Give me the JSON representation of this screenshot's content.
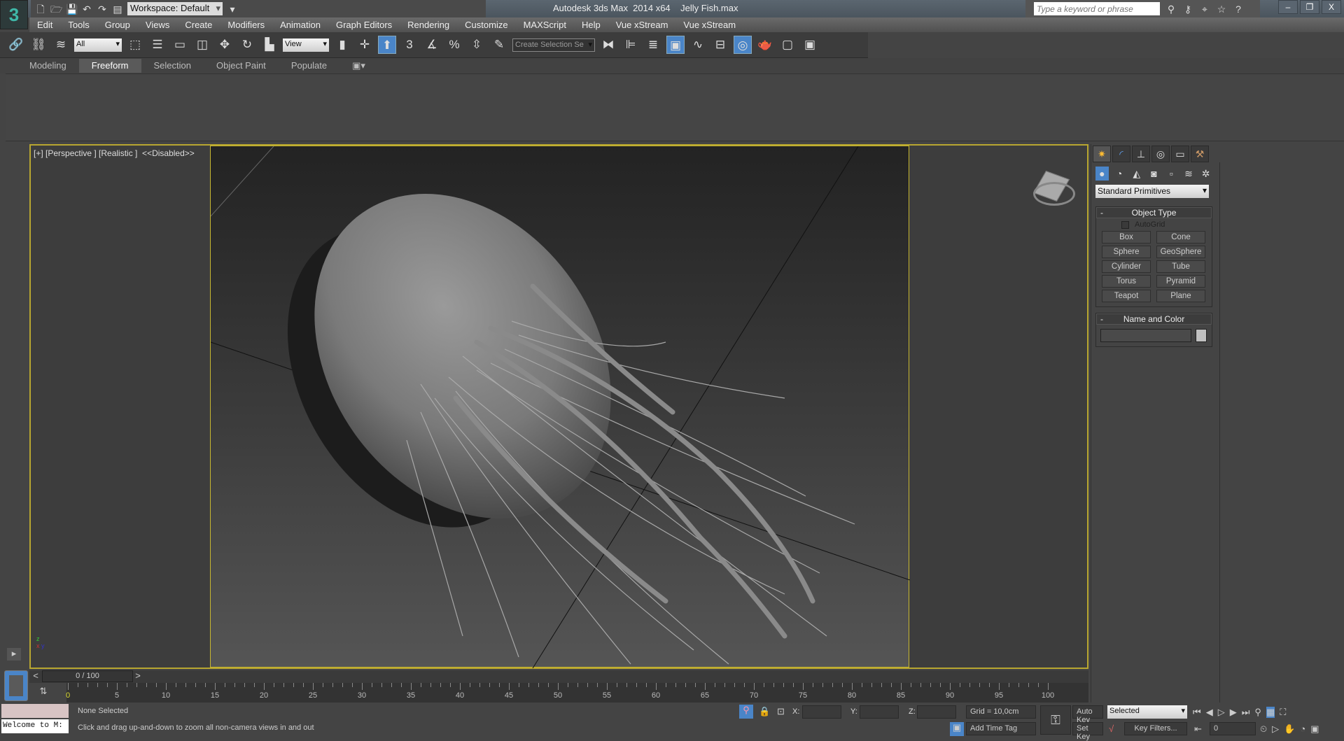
{
  "title_bar": {
    "app_title": "Autodesk 3ds Max  2014 x64",
    "file_name": "Jelly Fish.max",
    "workspace": "Workspace: Default",
    "search_placeholder": "Type a keyword or phrase"
  },
  "menu": [
    "Edit",
    "Tools",
    "Group",
    "Views",
    "Create",
    "Modifiers",
    "Animation",
    "Graph Editors",
    "Rendering",
    "Customize",
    "MAXScript",
    "Help",
    "Vue xStream",
    "Vue xStream"
  ],
  "toolbar": {
    "selection_filter": "All",
    "ref_coord": "View",
    "snap_label": "3",
    "selection_set_placeholder": "Create Selection Se"
  },
  "ribbon_tabs": [
    {
      "label": "Modeling",
      "active": false
    },
    {
      "label": "Freeform",
      "active": true
    },
    {
      "label": "Selection",
      "active": false
    },
    {
      "label": "Object Paint",
      "active": false
    },
    {
      "label": "Populate",
      "active": false
    }
  ],
  "viewport": {
    "label": "[+] [Perspective ] [Realistic ]  <<Disabled>>"
  },
  "command_panel": {
    "category": "Standard Primitives",
    "object_type_title": "Object Type",
    "autogrid": "AutoGrid",
    "buttons": [
      "Box",
      "Cone",
      "Sphere",
      "GeoSphere",
      "Cylinder",
      "Tube",
      "Torus",
      "Pyramid",
      "Teapot",
      "Plane"
    ],
    "name_color_title": "Name and Color",
    "collapse": "-",
    "object_color": "#c0c0c0"
  },
  "timeline": {
    "frame": "0 / 100",
    "prev": "<",
    "next": ">",
    "ticks": [
      "0",
      "5",
      "10",
      "15",
      "20",
      "25",
      "30",
      "35",
      "40",
      "45",
      "50",
      "55",
      "60",
      "65",
      "70",
      "75",
      "80",
      "85",
      "90",
      "95",
      "100"
    ]
  },
  "status": {
    "maxscript_listener": "Welcome to M:",
    "selection": "None Selected",
    "prompt": "Click and drag up-and-down to zoom all non-camera views in and out",
    "x_label": "X:",
    "y_label": "Y:",
    "z_label": "Z:",
    "grid": "Grid = 10,0cm",
    "add_time_tag": "Add Time Tag",
    "auto_key": "Auto Key",
    "set_key": "Set Key",
    "key_mode": "Selected",
    "key_filters": "Key Filters...",
    "current_frame": "0"
  },
  "colors": {
    "accent": "#4a85c8",
    "viewport_border": "#b8a630"
  }
}
